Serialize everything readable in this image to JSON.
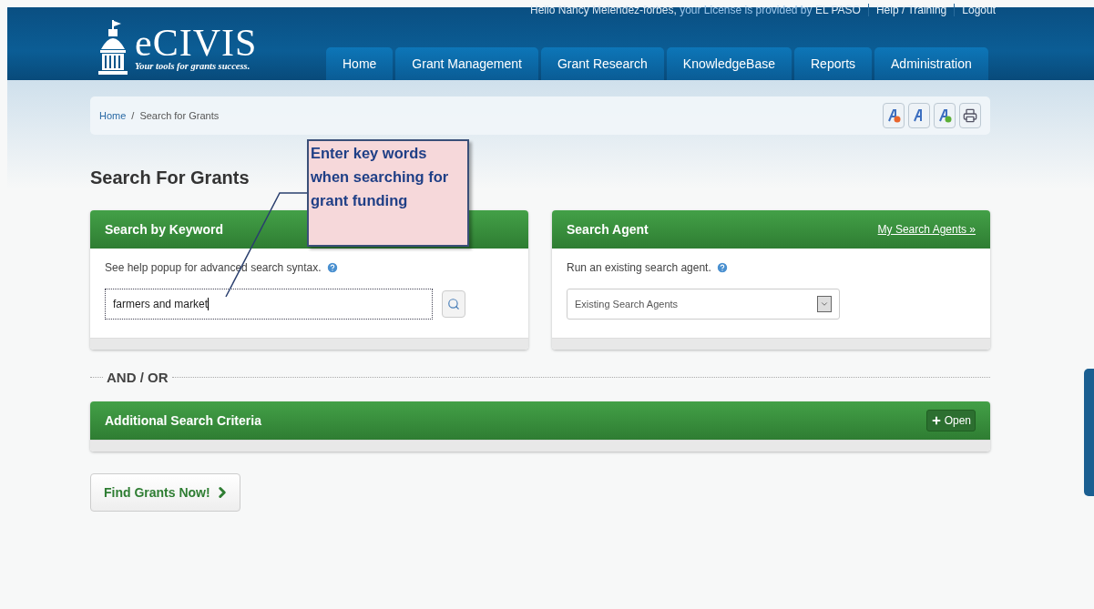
{
  "header": {
    "logo_name": "eCIVIS",
    "tagline": "Your tools for grants success.",
    "greeting": "Hello Nancy Melendez-forbes,",
    "license_text": "your License is provided by",
    "license_org": "EL PASO",
    "links": [
      "Help / Training",
      "Logout"
    ]
  },
  "nav": [
    "Home",
    "Grant Management",
    "Grant Research",
    "KnowledgeBase",
    "Reports",
    "Administration"
  ],
  "breadcrumb": [
    {
      "label": "Home",
      "link": true
    },
    {
      "label": "Search for Grants",
      "link": false
    }
  ],
  "breadcrumb_separator": "/",
  "page_title": "Search For Grants",
  "keyword_panel": {
    "title": "Search by Keyword",
    "hint": "See help popup for advanced search syntax.",
    "value": "farmers and market"
  },
  "agent_panel": {
    "title": "Search Agent",
    "link": "My Search Agents »",
    "hint": "Run an existing search agent.",
    "select": "Existing Search Agents"
  },
  "divider_label": "AND / OR",
  "criteria_panel": {
    "title": "Additional Search Criteria",
    "button": "Open",
    "expanded": false
  },
  "find_button": "Find Grants Now!",
  "callout": {
    "text": "Enter key words when searching for grant funding"
  }
}
